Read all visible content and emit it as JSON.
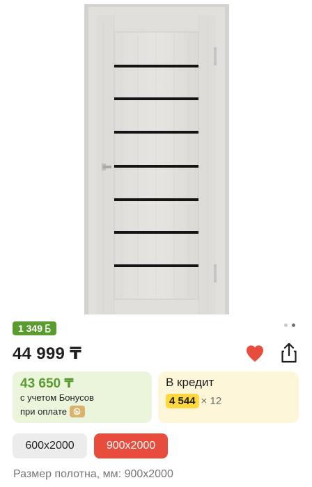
{
  "gallery": {
    "product_image": "door-photo",
    "dots_count": 2,
    "active_dot": 1
  },
  "bonus_badge": {
    "amount": "1 349",
    "icon": "bonus-b-icon"
  },
  "price": {
    "value": "44 999 ₸"
  },
  "actions": {
    "favorite_icon": "heart-icon",
    "favorite_color": "#e84c3d",
    "share_icon": "share-icon"
  },
  "bonus_card": {
    "price": "43 650 ₸",
    "line1": "с учетом Бонусов",
    "line2": "при оплате",
    "coin_icon": "bonus-coin-icon",
    "accent": "#5a9b2f"
  },
  "credit_card": {
    "title": "В кредит",
    "monthly": "4 544",
    "months": "× 12",
    "accent": "#ffd83d"
  },
  "sizes": {
    "options": [
      "600x2000",
      "900x2000"
    ],
    "selected": "900x2000",
    "selected_color": "#e84c3d"
  },
  "size_caption": {
    "label": "Размер полотна, мм:",
    "value": "900x2000"
  }
}
